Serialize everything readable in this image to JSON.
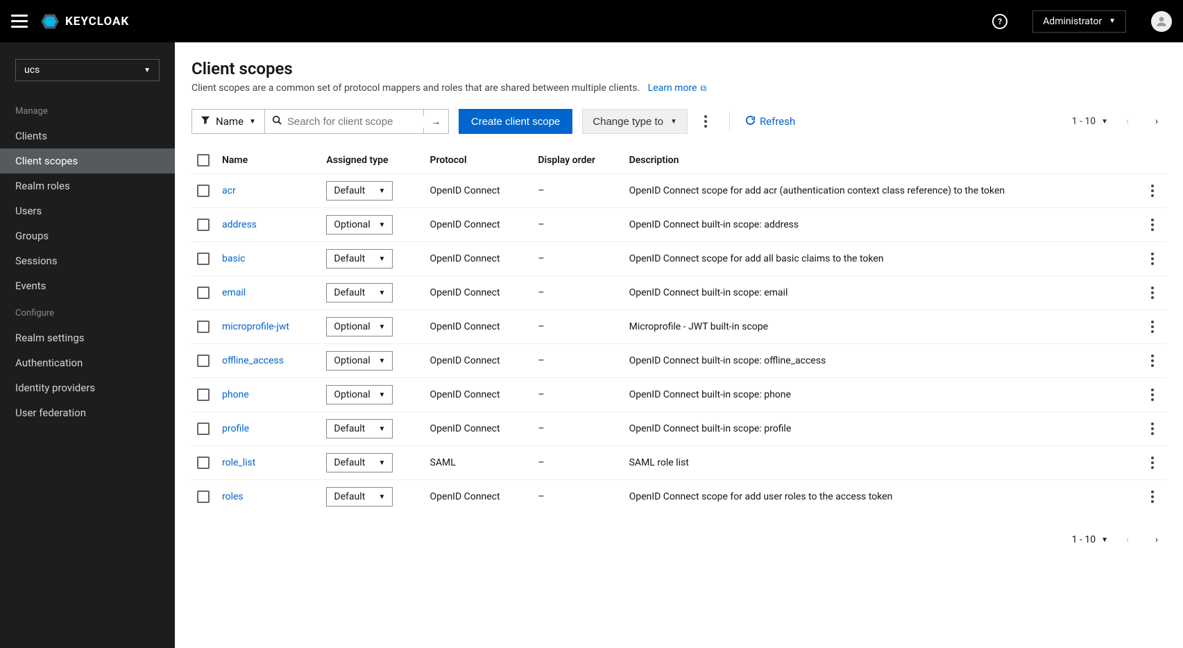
{
  "header": {
    "brand": "KEYCLOAK",
    "user_label": "Administrator"
  },
  "sidebar": {
    "realm_selected": "ucs",
    "manage_label": "Manage",
    "configure_label": "Configure",
    "manage_items": [
      {
        "label": "Clients"
      },
      {
        "label": "Client scopes"
      },
      {
        "label": "Realm roles"
      },
      {
        "label": "Users"
      },
      {
        "label": "Groups"
      },
      {
        "label": "Sessions"
      },
      {
        "label": "Events"
      }
    ],
    "configure_items": [
      {
        "label": "Realm settings"
      },
      {
        "label": "Authentication"
      },
      {
        "label": "Identity providers"
      },
      {
        "label": "User federation"
      }
    ]
  },
  "page": {
    "title": "Client scopes",
    "description": "Client scopes are a common set of protocol mappers and roles that are shared between multiple clients.",
    "learn_more": "Learn more"
  },
  "toolbar": {
    "filter_label": "Name",
    "search_placeholder": "Search for client scope",
    "create_label": "Create client scope",
    "change_type_label": "Change type to",
    "refresh_label": "Refresh",
    "range_label": "1 - 10"
  },
  "table": {
    "headers": {
      "name": "Name",
      "assigned": "Assigned type",
      "protocol": "Protocol",
      "display_order": "Display order",
      "description": "Description"
    },
    "rows": [
      {
        "name": "acr",
        "assigned": "Default",
        "protocol": "OpenID Connect",
        "display_order": "–",
        "description": "OpenID Connect scope for add acr (authentication context class reference) to the token"
      },
      {
        "name": "address",
        "assigned": "Optional",
        "protocol": "OpenID Connect",
        "display_order": "–",
        "description": "OpenID Connect built-in scope: address"
      },
      {
        "name": "basic",
        "assigned": "Default",
        "protocol": "OpenID Connect",
        "display_order": "–",
        "description": "OpenID Connect scope for add all basic claims to the token"
      },
      {
        "name": "email",
        "assigned": "Default",
        "protocol": "OpenID Connect",
        "display_order": "–",
        "description": "OpenID Connect built-in scope: email"
      },
      {
        "name": "microprofile-jwt",
        "assigned": "Optional",
        "protocol": "OpenID Connect",
        "display_order": "–",
        "description": "Microprofile - JWT built-in scope"
      },
      {
        "name": "offline_access",
        "assigned": "Optional",
        "protocol": "OpenID Connect",
        "display_order": "–",
        "description": "OpenID Connect built-in scope: offline_access"
      },
      {
        "name": "phone",
        "assigned": "Optional",
        "protocol": "OpenID Connect",
        "display_order": "–",
        "description": "OpenID Connect built-in scope: phone"
      },
      {
        "name": "profile",
        "assigned": "Default",
        "protocol": "OpenID Connect",
        "display_order": "–",
        "description": "OpenID Connect built-in scope: profile"
      },
      {
        "name": "role_list",
        "assigned": "Default",
        "protocol": "SAML",
        "display_order": "–",
        "description": "SAML role list"
      },
      {
        "name": "roles",
        "assigned": "Default",
        "protocol": "OpenID Connect",
        "display_order": "–",
        "description": "OpenID Connect scope for add user roles to the access token"
      }
    ]
  },
  "footer": {
    "range_label": "1 - 10"
  }
}
